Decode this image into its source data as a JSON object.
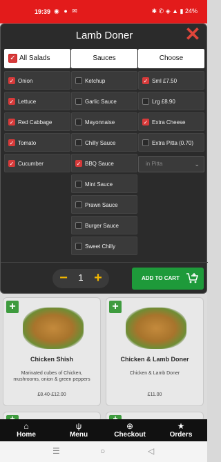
{
  "status_bar": {
    "time": "19:39",
    "left_icons": "◉ ● ✉",
    "right_icons": "✱ ✆ ◈ ▲ ▮ 24%"
  },
  "modal": {
    "title": "Lamb Doner",
    "close_icon": "close-icon",
    "salads": {
      "header": "All Salads",
      "header_checked": true,
      "items": [
        {
          "label": "Onion",
          "checked": true
        },
        {
          "label": "Lettuce",
          "checked": true
        },
        {
          "label": "Red Cabbage",
          "checked": true
        },
        {
          "label": "Tomato",
          "checked": true
        },
        {
          "label": "Cucumber",
          "checked": true
        }
      ]
    },
    "sauces": {
      "header": "Sauces",
      "items": [
        {
          "label": "Ketchup",
          "checked": false
        },
        {
          "label": "Garlic Sauce",
          "checked": false
        },
        {
          "label": "Mayonnaise",
          "checked": false
        },
        {
          "label": "Chilly Sauce",
          "checked": false
        },
        {
          "label": "BBQ Sauce",
          "checked": true
        },
        {
          "label": "Mint Sauce",
          "checked": false
        },
        {
          "label": "Prawn Sauce",
          "checked": false
        },
        {
          "label": "Burger Sauce",
          "checked": false
        },
        {
          "label": "Sweet Chilly",
          "checked": false
        }
      ]
    },
    "choose": {
      "header": "Choose",
      "items": [
        {
          "label": "Sml £7.50",
          "checked": true
        },
        {
          "label": "Lrg £8.90",
          "checked": false
        },
        {
          "label": "Extra Cheese",
          "checked": true
        },
        {
          "label": "Extra Pitta (0.70)",
          "checked": false
        }
      ],
      "select_value": "in Pitta"
    },
    "quantity": "1",
    "add_to_cart_label": "ADD TO CART"
  },
  "menu_cards": [
    {
      "name": "Chicken Shish",
      "description": "Marinated cubes of Chicken, mushrooms, onion & green peppers",
      "price": "£8.40-£12.00"
    },
    {
      "name": "Chicken & Lamb Doner",
      "description": "Chicken & Lamb Doner",
      "price": "£11.00"
    }
  ],
  "bottom_nav": [
    {
      "label": "Home",
      "icon": "home-icon",
      "glyph": "⌂"
    },
    {
      "label": "Menu",
      "icon": "cutlery-icon",
      "glyph": "ψ"
    },
    {
      "label": "Checkout",
      "icon": "basket-icon",
      "glyph": "⊕"
    },
    {
      "label": "Orders",
      "icon": "star-icon",
      "glyph": "★"
    }
  ],
  "colors": {
    "status_bar": "#e31b1b",
    "accent_yellow": "#f2b600",
    "add_cart_green": "#1e9a3a",
    "check_red": "#d63a3a",
    "modal_bg": "#2b2b2b"
  }
}
